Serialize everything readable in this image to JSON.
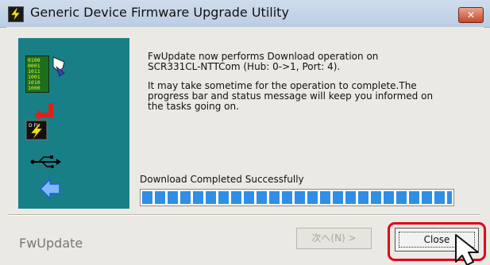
{
  "window": {
    "title": "Generic Device Firmware Upgrade Utility",
    "close_glyph": "✕"
  },
  "side_panel": {
    "binary_rows": [
      "0100",
      "0001",
      "1011",
      "1001",
      "1010",
      "1000"
    ],
    "chip_label": "D FU",
    "icons": [
      "binary-data-icon",
      "hand-pointer-icon",
      "red-arrow-icon",
      "dfu-chip-icon",
      "usb-icon",
      "back-arrow-icon"
    ]
  },
  "message": {
    "line1": "FwUpdate now performs Download operation on",
    "line2": "SCR331CL-NTTCom (Hub: 0->1, Port: 4).",
    "line3": "It may take sometime for the operation to complete.The",
    "line4": "progress bar and status message will keep you informed on",
    "line5": "the tasks going on."
  },
  "status_text": "Download Completed Successfully",
  "progress": {
    "percent": 100
  },
  "footer": {
    "label": "FwUpdate",
    "next_label": "次へ(N) >",
    "close_label": "Close"
  },
  "colors": {
    "side_panel": "#187f86",
    "progress": "#2f8ee6",
    "highlight": "#e0001b"
  }
}
